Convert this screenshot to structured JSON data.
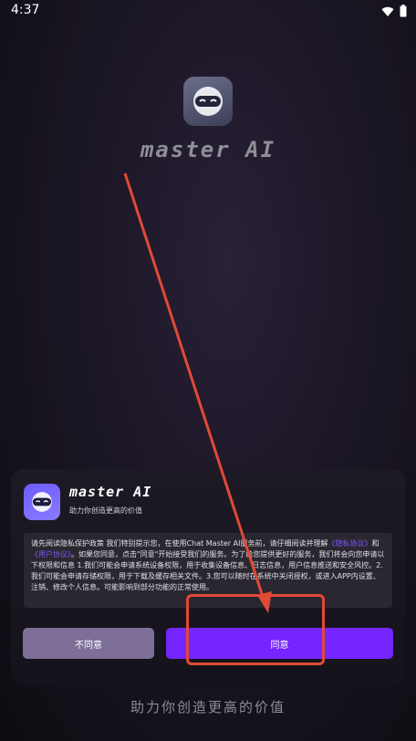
{
  "status_bar": {
    "time": "4:37",
    "icons": [
      "wifi-icon",
      "battery-icon"
    ]
  },
  "splash": {
    "brand": "master AI"
  },
  "dialog": {
    "title": "master AI",
    "subtitle": "助力你创造更高的价值",
    "policy": {
      "part1": "请先阅读隐私保护政策 我们特别提示您，在使用Chat Master AI服务前，请仔细阅读并理解",
      "privacy_link": "《隐私协议》",
      "and": "和",
      "user_link": "《用户协议》",
      "part2": "。如果您同意，点击\"同意\"开始接受我们的服务。为了给您提供更好的服务，我们将会向您申请以下权限和信息 1.我们可能会申请系统设备权限，用于收集设备信息、日志信息，用户信息推送和安全风控。2.我们可能会申请存储权限，用于下载及缓存相关文件。3.您可以随时在系统中关闭授权，或进入APP内设置、注销、修改个人信息。可能影响到部分功能的正常使用。"
    },
    "buttons": {
      "disagree": "不同意",
      "agree": "同意"
    }
  },
  "footer": {
    "slogan": "助力你创造更高的价值"
  },
  "colors": {
    "accent": "#7525ff",
    "secondary_button": "#7d6f98",
    "annotation": "#e04a36"
  }
}
